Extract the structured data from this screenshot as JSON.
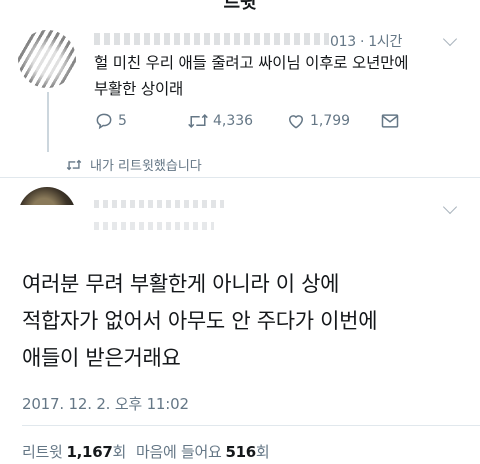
{
  "header": {
    "title": "트윗"
  },
  "quoted_tweet": {
    "meta": "013 · 1시간",
    "text_line1": "헐 미친 우리 애들 줄려고 싸이님 이후로 오년만에",
    "text_line2": "부활한 상이래",
    "actions": {
      "reply_count": "5",
      "retweet_count": "4,336",
      "like_count": "1,799"
    },
    "icons": {
      "reply": "reply-icon",
      "retweet": "retweet-icon",
      "like": "heart-icon",
      "dm": "envelope-icon",
      "menu": "chevron-down-icon"
    }
  },
  "retweet_notice": "내가 리트윗했습니다",
  "main_tweet": {
    "text_line1": "여러분 무려 부활한게 아니라 이 상에",
    "text_line2": "적합자가 없어서 아무도 안 주다가 이번에",
    "text_line3": "애들이 받은거래요",
    "timestamp": "2017. 12. 2. 오후 11:02"
  },
  "stats": {
    "retweet_label": "리트윗",
    "retweet_count": "1,167",
    "retweet_unit": "회",
    "like_label": "마음에 들어요",
    "like_count": "516",
    "like_unit": "회"
  },
  "colors": {
    "text": "#14171a",
    "secondary": "#657786",
    "divider": "#e1e8ed"
  }
}
